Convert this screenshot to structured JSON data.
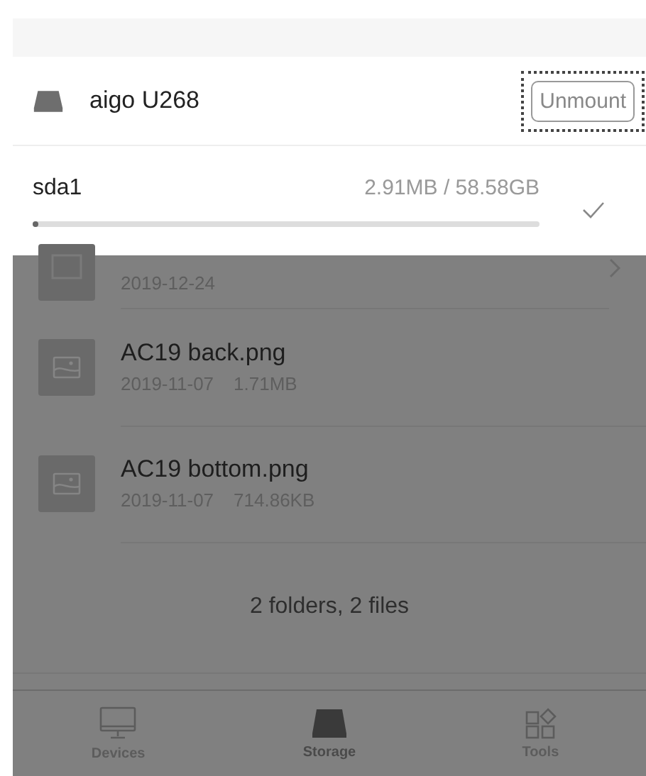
{
  "device": {
    "name": "aigo U268",
    "action": {
      "label": "Unmount",
      "focused": true
    }
  },
  "partition": {
    "name": "sda1",
    "usage": "2.91MB / 58.58GB",
    "level": 0.01,
    "selected": true
  },
  "files": [
    {
      "kind": "folder",
      "date": "2019-12-24"
    },
    {
      "kind": "image",
      "name": "AC19 back.png",
      "date": "2019-11-07",
      "size": "1.71MB"
    },
    {
      "kind": "image",
      "name": "AC19 bottom.png",
      "date": "2019-11-07",
      "size": "714.86KB"
    }
  ],
  "summary": "2 folders, 2 files",
  "tabs": [
    {
      "kind": "devices",
      "label": "Devices",
      "selected": false
    },
    {
      "kind": "storage",
      "label": "Storage",
      "selected": true
    },
    {
      "kind": "tools",
      "label": "Tools",
      "selected": false
    }
  ]
}
